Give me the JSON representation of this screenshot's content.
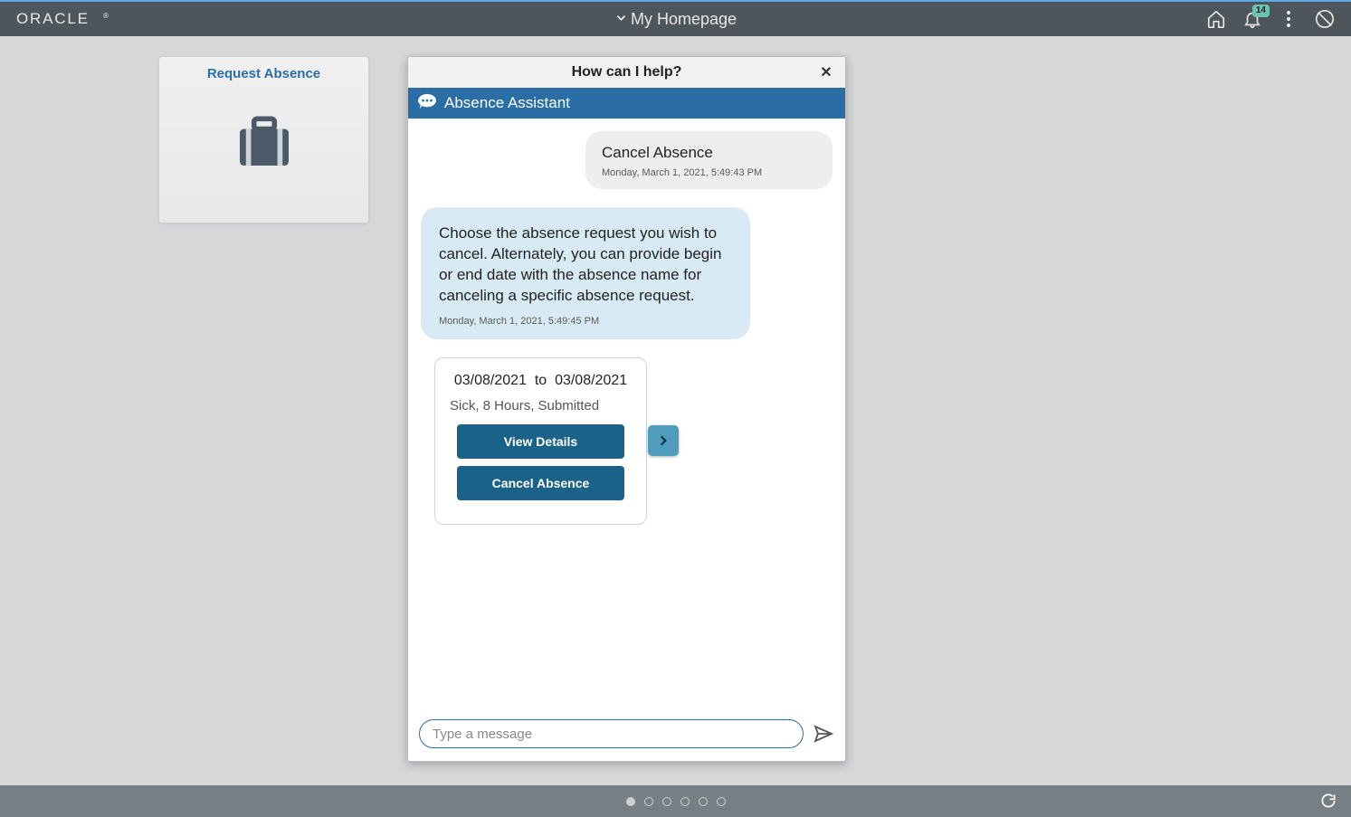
{
  "brand": "ORACLE",
  "page_title": "My Homepage",
  "notifications_count": "14",
  "tile": {
    "title": "Request Absence"
  },
  "chat": {
    "header": "How can I help?",
    "assistant_name": "Absence Assistant",
    "user_msg": {
      "text": "Cancel Absence",
      "time": "Monday, March 1, 2021, 5:49:43 PM"
    },
    "bot_msg": {
      "text": "Choose the absence request you wish to cancel. Alternately, you can provide begin or end date with the absence name for canceling a specific absence request.",
      "time": "Monday, March 1, 2021, 5:49:45 PM"
    },
    "card": {
      "date_from": "03/08/2021",
      "date_to": "03/08/2021",
      "joiner": "to",
      "sub": "Sick, 8 Hours, Submitted",
      "view_btn": "View Details",
      "cancel_btn": "Cancel Absence"
    },
    "input_placeholder": "Type a message"
  }
}
